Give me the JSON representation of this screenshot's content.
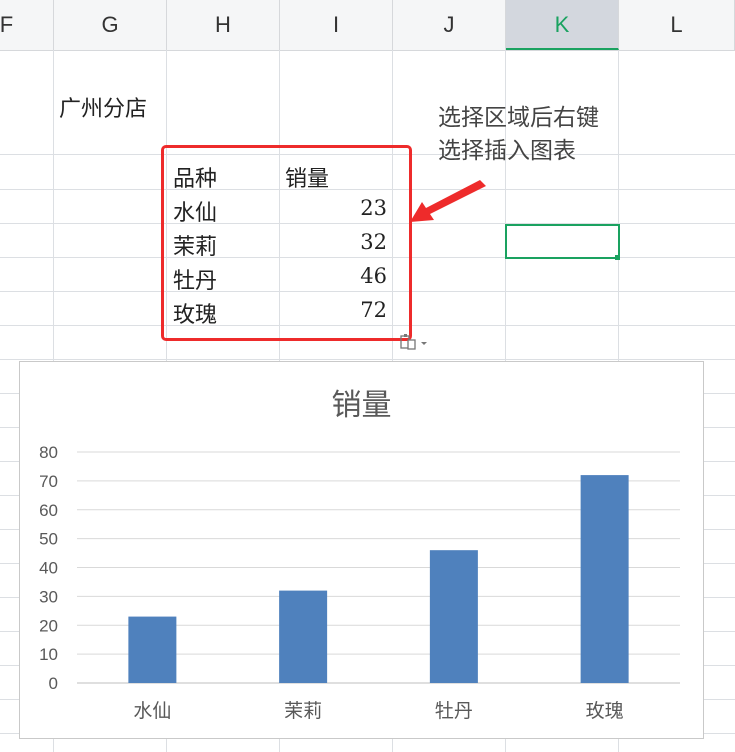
{
  "columns": [
    "F",
    "G",
    "H",
    "I",
    "J",
    "K",
    "L"
  ],
  "selected_column": "K",
  "store_label": "广州分店",
  "table": {
    "headers": [
      "品种",
      "销量"
    ],
    "rows": [
      {
        "name": "水仙",
        "value": "23"
      },
      {
        "name": "茉莉",
        "value": "32"
      },
      {
        "name": "牡丹",
        "value": "46"
      },
      {
        "name": "玫瑰",
        "value": "72"
      }
    ]
  },
  "annotation": {
    "line1": "选择区域后右键",
    "line2": "选择插入图表"
  },
  "paste_options_icon": "paste-options-icon",
  "colors": {
    "bar": "#4f81bd",
    "highlight": "#ee2b2b",
    "active_cell": "#1aa260"
  },
  "chart_data": {
    "type": "bar",
    "title": "销量",
    "categories": [
      "水仙",
      "茉莉",
      "牡丹",
      "玫瑰"
    ],
    "values": [
      23,
      32,
      46,
      72
    ],
    "ylim": [
      0,
      80
    ],
    "yticks": [
      0,
      10,
      20,
      30,
      40,
      50,
      60,
      70,
      80
    ],
    "grid": true
  }
}
